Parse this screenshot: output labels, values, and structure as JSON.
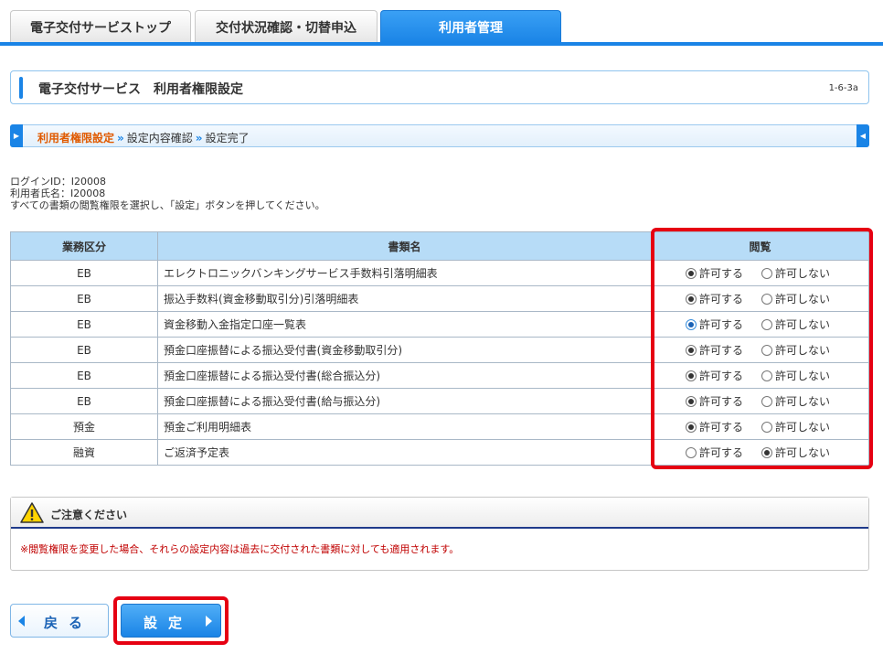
{
  "tabs": [
    {
      "label": "電子交付サービストップ"
    },
    {
      "label": "交付状況確認・切替申込"
    },
    {
      "label": "利用者管理"
    }
  ],
  "title": {
    "text": "電子交付サービス　利用者権限設定",
    "code": "1-6-3a"
  },
  "steps": {
    "current": "利用者権限設定",
    "step2": "設定内容確認",
    "step3": "設定完了",
    "separator": "»"
  },
  "info": {
    "login_id_label": "ログインID：",
    "login_id": "I20008",
    "user_name_label": "利用者氏名：",
    "user_name": "I20008",
    "instruction": "すべての書類の閲覧権限を選択し、「設定」ボタンを押してください。"
  },
  "table": {
    "headers": {
      "category": "業務区分",
      "document": "書類名",
      "view": "閲覧"
    },
    "allow_label": "許可する",
    "deny_label": "許可しない",
    "rows": [
      {
        "category": "EB",
        "document": "エレクトロニックバンキングサービス手数料引落明細表",
        "selected": "allow"
      },
      {
        "category": "EB",
        "document": "振込手数料(資金移動取引分)引落明細表",
        "selected": "allow"
      },
      {
        "category": "EB",
        "document": "資金移動入金指定口座一覧表",
        "selected": "allow"
      },
      {
        "category": "EB",
        "document": "預金口座振替による振込受付書(資金移動取引分)",
        "selected": "allow"
      },
      {
        "category": "EB",
        "document": "預金口座振替による振込受付書(総合振込分)",
        "selected": "allow"
      },
      {
        "category": "EB",
        "document": "預金口座振替による振込受付書(給与振込分)",
        "selected": "allow"
      },
      {
        "category": "預金",
        "document": "預金ご利用明細表",
        "selected": "allow"
      },
      {
        "category": "融資",
        "document": "ご返済予定表",
        "selected": "deny"
      }
    ]
  },
  "caution": {
    "title": "ご注意ください",
    "text": "※閲覧権限を変更した場合、それらの設定内容は過去に交付された書類に対しても適用されます。"
  },
  "buttons": {
    "back": "戻る",
    "set": "設定"
  },
  "colors": {
    "accent": "#1a84e6",
    "highlight": "#e60012",
    "step_current": "#e05a00",
    "caution_text": "#c00000"
  }
}
